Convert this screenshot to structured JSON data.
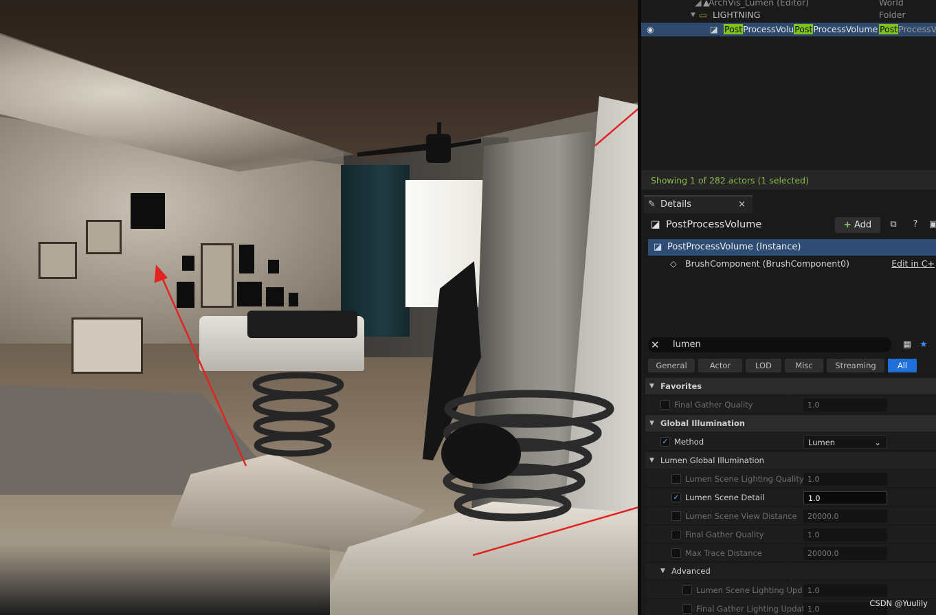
{
  "outliner": {
    "row_archvis": {
      "name": "ArchVis_Lumen (Editor)",
      "type": "World"
    },
    "row_lightning": {
      "name": "LIGHTNING",
      "type": "Folder"
    },
    "row_ppv": {
      "name_part1_hl": "Post",
      "name_part2": "ProcessVolu",
      "name_part3_hl": "Post",
      "name_part4": "ProcessVolume",
      "type_hl": "Post",
      "type_rest": "ProcessVo"
    },
    "status": "Showing 1 of 282 actors (1 selected)"
  },
  "details": {
    "tab_label": "Details",
    "title": "PostProcessVolume",
    "add_label": "Add",
    "instance_label": "PostProcessVolume (Instance)",
    "brush_label": "BrushComponent (BrushComponent0)",
    "edit_cpp_label": "Edit in C+",
    "search_value": "lumen",
    "filter_tabs": [
      "General",
      "Actor",
      "LOD",
      "Misc",
      "Streaming",
      "All"
    ],
    "sections": {
      "favorites": "Favorites",
      "global_illumination": "Global Illumination",
      "lumen_gi": "Lumen Global Illumination",
      "advanced": "Advanced"
    },
    "props": {
      "fav_final_gather": {
        "label": "Final Gather Quality",
        "value": "1.0"
      },
      "method": {
        "label": "Method",
        "value": "Lumen"
      },
      "scene_lighting_quality": {
        "label": "Lumen Scene Lighting Quality",
        "value": "1.0"
      },
      "scene_detail": {
        "label": "Lumen Scene Detail",
        "value": "1.0"
      },
      "scene_view_distance": {
        "label": "Lumen Scene View Distance",
        "value": "20000.0"
      },
      "final_gather_quality": {
        "label": "Final Gather Quality",
        "value": "1.0"
      },
      "max_trace_distance": {
        "label": "Max Trace Distance",
        "value": "20000.0"
      },
      "scene_lighting_upd": {
        "label": "Lumen Scene Lighting Upd...",
        "value": "1.0"
      },
      "final_gather_lighting_upd": {
        "label": "Final Gather Lighting Updat...",
        "value": "1.0"
      }
    }
  },
  "watermark": "CSDN @Yuulily",
  "colors": {
    "highlight": "#7fc21a",
    "selection": "#2e4c74",
    "accent": "#1e6fd9",
    "annotation_arrow": "#e32222"
  }
}
